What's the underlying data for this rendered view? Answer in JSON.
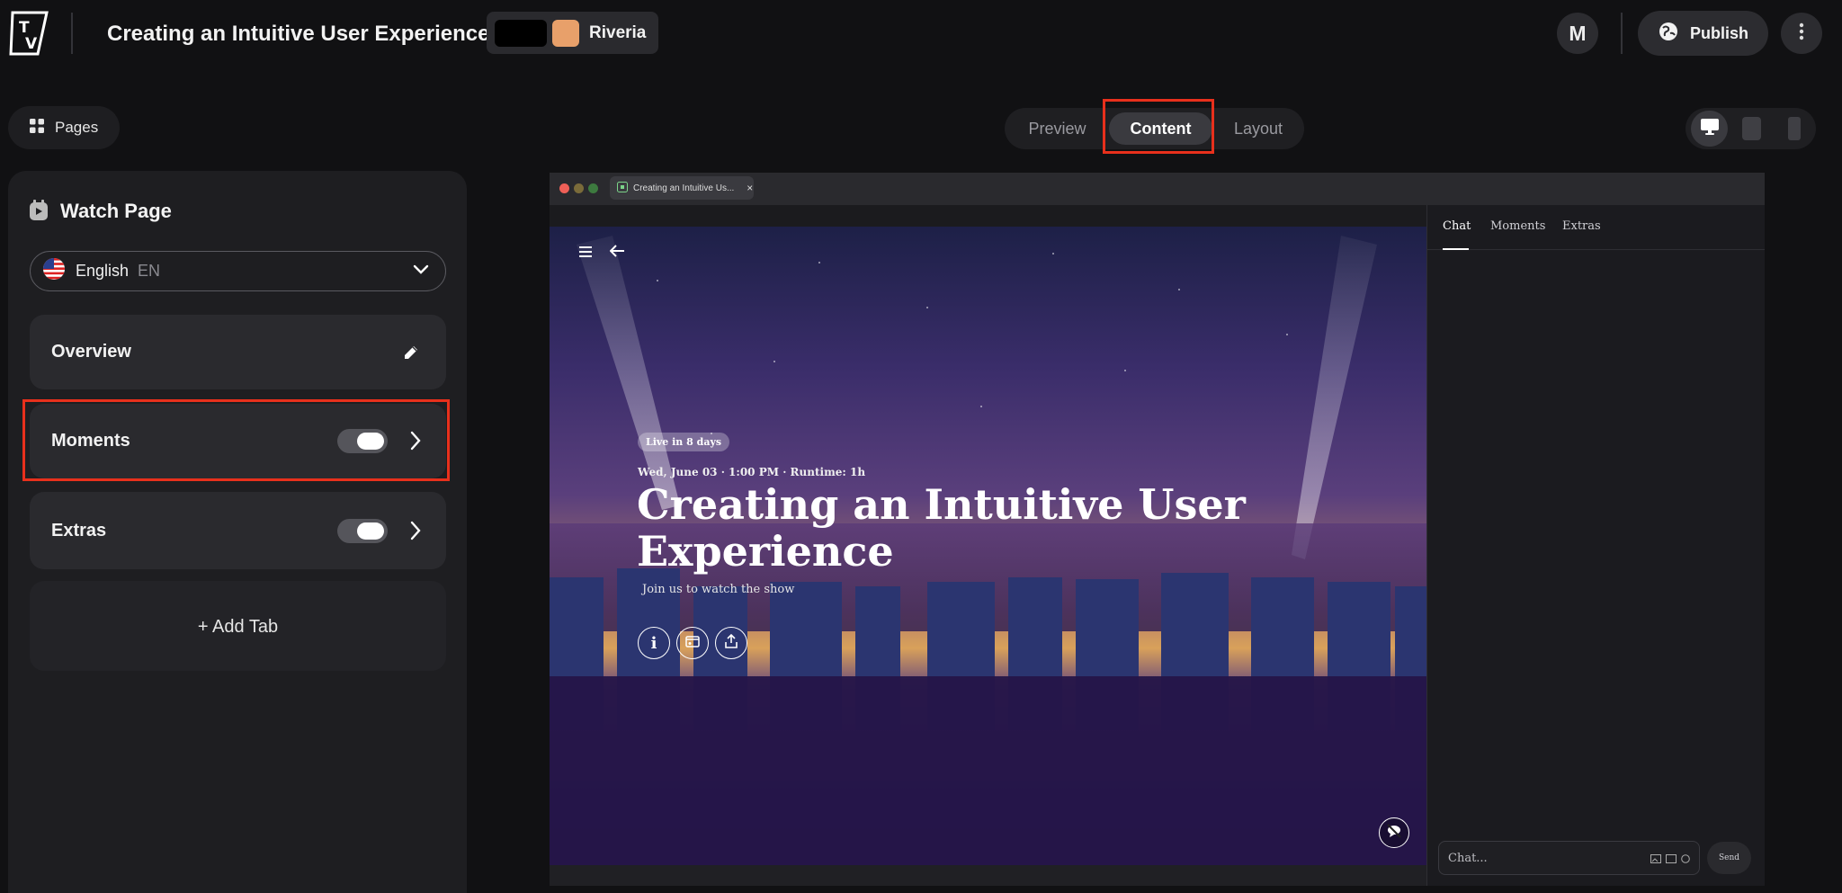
{
  "app": {
    "title": "Creating an Intuitive User Experience",
    "theme_name": "Riveria",
    "theme_colors": [
      "#000000",
      "#e8a06a"
    ],
    "avatar_initial": "M",
    "publish_label": "Publish"
  },
  "sidebar": {
    "pages_label": "Pages",
    "page_title": "Watch Page",
    "language": {
      "name": "English",
      "code": "EN"
    },
    "tabs": [
      {
        "label": "Overview"
      },
      {
        "label": "Moments",
        "enabled": true
      },
      {
        "label": "Extras",
        "enabled": true
      }
    ],
    "add_tab_label": "+ Add Tab"
  },
  "mode_tabs": {
    "preview": "Preview",
    "content": "Content",
    "layout": "Layout",
    "active": "Content"
  },
  "preview": {
    "browser_tab": "Creating an Intuitive Us...",
    "badge": "Live in 8 days",
    "meta": "Wed, June 03 · 1:00 PM · Runtime: 1h",
    "title": "Creating an Intuitive User Experience",
    "subtitle": "Join us to watch the show",
    "chat_tabs": [
      "Chat",
      "Moments",
      "Extras"
    ],
    "chat_placeholder": "Chat...",
    "send_label": "Send"
  },
  "colors": {
    "highlight": "#e8301c",
    "background": "#111113"
  }
}
